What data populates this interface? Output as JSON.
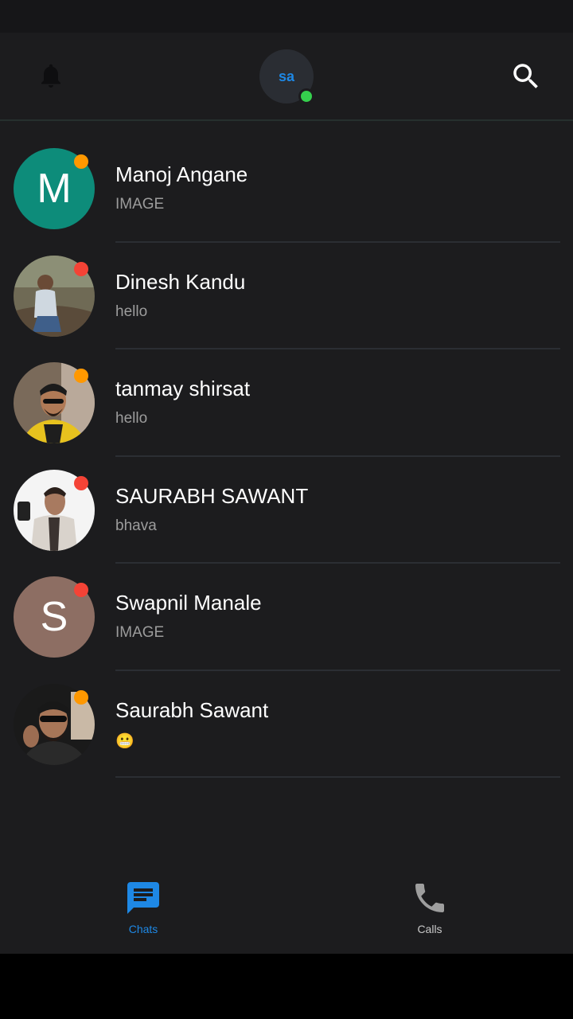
{
  "header": {
    "user_initials": "sa",
    "online_color": "#35d04d",
    "icons": {
      "left": "bell-icon",
      "right": "search-icon"
    }
  },
  "chats": [
    {
      "name": "Manoj Angane",
      "preview": "IMAGE",
      "avatar": {
        "type": "letter",
        "letter": "M",
        "bg": "#0d8c7a"
      },
      "status_color": "#ff9800"
    },
    {
      "name": "Dinesh Kandu",
      "preview": "hello",
      "avatar": {
        "type": "photo"
      },
      "status_color": "#f44336"
    },
    {
      "name": "tanmay shirsat",
      "preview": "hello",
      "avatar": {
        "type": "photo"
      },
      "status_color": "#ff9800"
    },
    {
      "name": "SAURABH SAWANT",
      "preview": "bhava",
      "avatar": {
        "type": "photo"
      },
      "status_color": "#f44336"
    },
    {
      "name": "Swapnil Manale",
      "preview": "IMAGE",
      "avatar": {
        "type": "letter",
        "letter": "S",
        "bg": "#8d6e63"
      },
      "status_color": "#f44336"
    },
    {
      "name": "Saurabh Sawant",
      "preview": "😬",
      "avatar": {
        "type": "photo"
      },
      "status_color": "#ff9800"
    }
  ],
  "nav": {
    "chats_label": "Chats",
    "calls_label": "Calls",
    "active": "Chats",
    "active_color": "#1e88e5"
  }
}
